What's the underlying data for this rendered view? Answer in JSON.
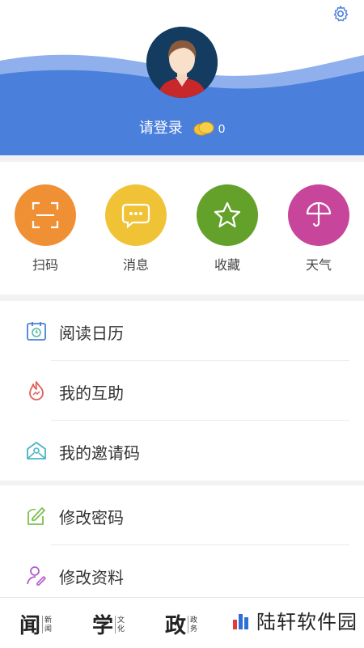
{
  "header": {
    "login_label": "请登录",
    "coin_count": "0"
  },
  "quick_actions": [
    {
      "label": "扫码",
      "icon": "scan-icon",
      "color": "#f09035"
    },
    {
      "label": "消息",
      "icon": "message-icon",
      "color": "#f0c337"
    },
    {
      "label": "收藏",
      "icon": "star-icon",
      "color": "#63a12a"
    },
    {
      "label": "天气",
      "icon": "umbrella-icon",
      "color": "#c7459a"
    }
  ],
  "menu_group_1": [
    {
      "label": "阅读日历",
      "icon": "calendar-icon"
    },
    {
      "label": "我的互助",
      "icon": "flame-icon"
    },
    {
      "label": "我的邀请码",
      "icon": "envelope-icon"
    }
  ],
  "menu_group_2": [
    {
      "label": "修改密码",
      "icon": "edit-icon"
    },
    {
      "label": "修改资料",
      "icon": "user-edit-icon"
    }
  ],
  "bottom_tabs": [
    {
      "big": "闻",
      "small1": "新",
      "small2": "闻"
    },
    {
      "big": "学",
      "small1": "文",
      "small2": "化"
    },
    {
      "big": "政",
      "small1": "政",
      "small2": "务"
    }
  ],
  "brand": {
    "text": "陆轩软件园"
  },
  "colors": {
    "header_blue": "#4a7fdc",
    "accent": "#4a7fdc"
  }
}
